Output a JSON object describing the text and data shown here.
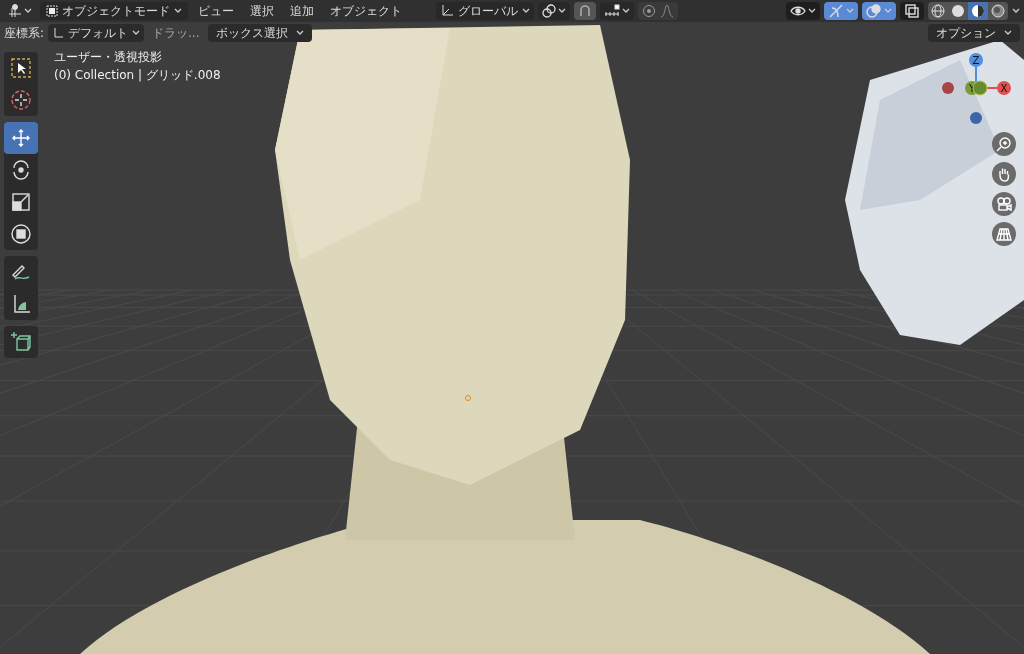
{
  "header": {
    "mode": "オブジェクトモード",
    "menus": [
      "ビュー",
      "選択",
      "追加",
      "オブジェクト"
    ],
    "orientation": "グローバル",
    "toggles": [
      {
        "kind": "visibility",
        "selected": false
      },
      {
        "kind": "gizmo",
        "selected": true
      },
      {
        "kind": "overlay",
        "selected": true
      },
      {
        "kind": "xray",
        "selected": false
      }
    ],
    "shading": [
      {
        "kind": "wireframe",
        "selected": false
      },
      {
        "kind": "solid",
        "selected": false
      },
      {
        "kind": "material",
        "selected": true
      },
      {
        "kind": "rendered",
        "selected": false
      }
    ]
  },
  "tool_header": {
    "label": "座標系:",
    "orientation": "デフォルト",
    "drag": "ドラッ...",
    "select_mode": "ボックス選択",
    "options": "オプション"
  },
  "view_info": [
    "ユーザー・透視投影",
    "(0) Collection | グリッド.008"
  ],
  "tools": [
    [
      {
        "kind": "select",
        "selected": false
      },
      {
        "kind": "cursor",
        "selected": false
      }
    ],
    [
      {
        "kind": "move",
        "selected": true
      },
      {
        "kind": "rotate",
        "selected": false
      },
      {
        "kind": "scale",
        "selected": false
      },
      {
        "kind": "transform",
        "selected": false
      }
    ],
    [
      {
        "kind": "annotate",
        "selected": false
      },
      {
        "kind": "measure",
        "selected": false
      }
    ],
    [
      {
        "kind": "add_cube",
        "selected": false
      }
    ]
  ],
  "gizmo": {
    "axes": [
      "Z",
      "Y",
      "X"
    ]
  },
  "nav_buttons": [
    {
      "kind": "zoom"
    },
    {
      "kind": "pan"
    },
    {
      "kind": "camera"
    },
    {
      "kind": "ortho"
    }
  ]
}
